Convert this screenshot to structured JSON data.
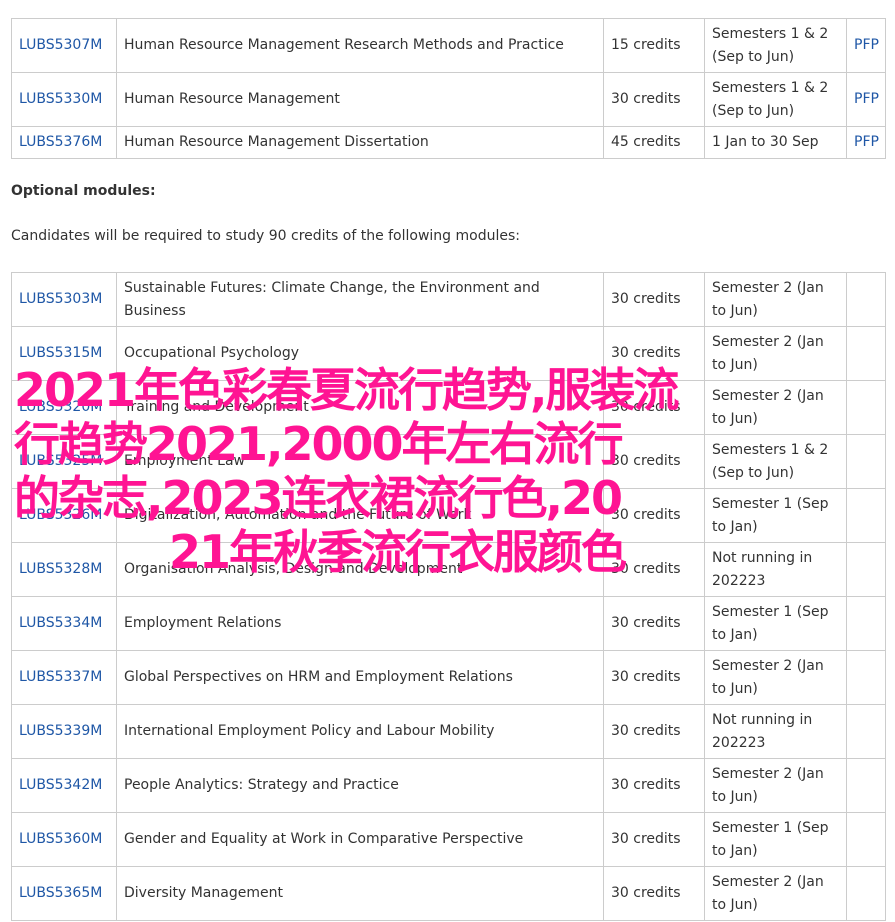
{
  "core_table": {
    "rows": [
      {
        "code": "LUBS5307M",
        "title": "Human Resource Management Research Methods and Practice",
        "credits": "15 credits",
        "semester_line1": "Semesters 1 & 2",
        "semester_line2": "(Sep to Jun)",
        "pfp": "PFP"
      },
      {
        "code": "LUBS5330M",
        "title": "Human Resource Management",
        "credits": "30 credits",
        "semester_line1": "Semesters 1 & 2",
        "semester_line2": "(Sep to Jun)",
        "pfp": "PFP"
      },
      {
        "code": "LUBS5376M",
        "title": "Human Resource Management Dissertation",
        "credits": "45 credits",
        "semester_line1": "1 Jan to 30 Sep",
        "semester_line2": "",
        "pfp": "PFP"
      }
    ]
  },
  "optional_section": {
    "heading": "Optional modules:",
    "description": "Candidates will be required to study 90 credits of the following modules:"
  },
  "optional_table": {
    "rows": [
      {
        "code": "LUBS5303M",
        "title_line1": "Sustainable Futures: Climate Change, the Environment and",
        "title_line2": "Business",
        "credits": "30 credits",
        "semester_line1": "Semester 2 (Jan",
        "semester_line2": "to Jun)"
      },
      {
        "code": "LUBS5315M",
        "title_line1": "Occupational Psychology",
        "title_line2": "",
        "credits": "30 credits",
        "semester_line1": "Semester 2 (Jan",
        "semester_line2": "to Jun)"
      },
      {
        "code": "LUBS5320M",
        "title_line1": "Training and Development",
        "title_line2": "",
        "credits": "30 credits",
        "semester_line1": "Semester 2 (Jan",
        "semester_line2": "to Jun)"
      },
      {
        "code": "LUBS5325M",
        "title_line1": "Employment Law",
        "title_line2": "",
        "credits": "30 credits",
        "semester_line1": "Semesters 1 & 2",
        "semester_line2": "(Sep to Jun)"
      },
      {
        "code": "LUBS5326M",
        "title_line1": "Digitalization, Automation and the Future of Work",
        "title_line2": "",
        "credits": "30 credits",
        "semester_line1": "Semester 1 (Sep",
        "semester_line2": "to Jan)"
      },
      {
        "code": "LUBS5328M",
        "title_line1": "Organisation Analysis, Design and Development",
        "title_line2": "",
        "credits": "30 credits",
        "semester_line1": "Not running in",
        "semester_line2": "202223"
      },
      {
        "code": "LUBS5334M",
        "title_line1": "Employment Relations",
        "title_line2": "",
        "credits": "30 credits",
        "semester_line1": "Semester 1 (Sep",
        "semester_line2": "to Jan)"
      },
      {
        "code": "LUBS5337M",
        "title_line1": "Global Perspectives on HRM and Employment Relations",
        "title_line2": "",
        "credits": "30 credits",
        "semester_line1": "Semester 2 (Jan",
        "semester_line2": "to Jun)"
      },
      {
        "code": "LUBS5339M",
        "title_line1": "International Employment Policy and Labour Mobility",
        "title_line2": "",
        "credits": "30 credits",
        "semester_line1": "Not running in",
        "semester_line2": "202223"
      },
      {
        "code": "LUBS5342M",
        "title_line1": "People Analytics: Strategy and Practice",
        "title_line2": "",
        "credits": "30 credits",
        "semester_line1": "Semester 2 (Jan",
        "semester_line2": "to Jun)"
      },
      {
        "code": "LUBS5360M",
        "title_line1": "Gender and Equality at Work in Comparative Perspective",
        "title_line2": "",
        "credits": "30 credits",
        "semester_line1": "Semester 1 (Sep",
        "semester_line2": "to Jan)"
      },
      {
        "code": "LUBS5365M",
        "title_line1": "Diversity Management",
        "title_line2": "",
        "credits": "30 credits",
        "semester_line1": "Semester 2 (Jan",
        "semester_line2": "to Jun)"
      }
    ]
  },
  "overlay": {
    "line1": "2021年色彩春夏流行趋势,服装流",
    "line2": "行趋势2021,2000年左右流行",
    "line3": "的杂志,2023连衣裙流行色,20",
    "line4": "21年秋季流行衣服颜色",
    "color": "#ff1493"
  },
  "colors": {
    "link": "#1f57a6",
    "text": "#333333",
    "border": "#cccccc"
  }
}
